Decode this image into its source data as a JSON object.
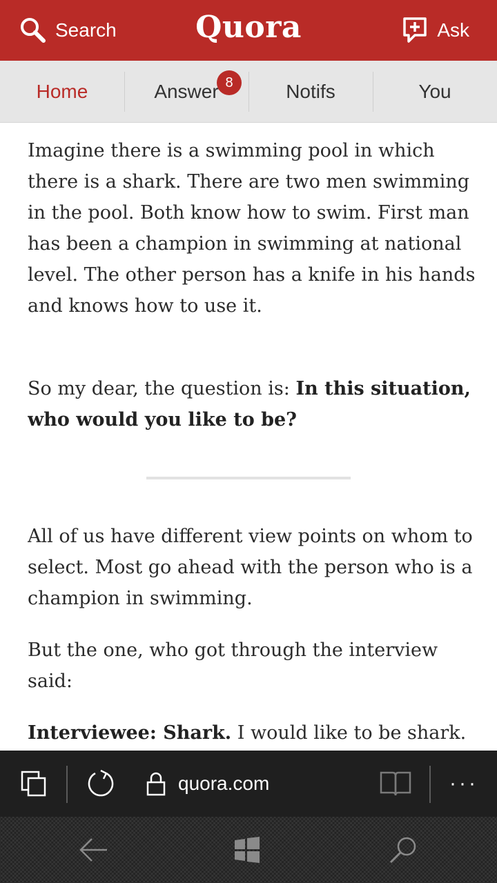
{
  "header": {
    "search_label": "Search",
    "logo_text": "Quora",
    "ask_label": "Ask",
    "bg_color": "#b92b27"
  },
  "tabs": [
    {
      "label": "Home",
      "active": true
    },
    {
      "label": "Answer",
      "badge": "8"
    },
    {
      "label": "Notifs"
    },
    {
      "label": "You"
    }
  ],
  "article": {
    "p1": "Imagine there is a swimming pool in which there is a shark. There are two men swimming in the pool. Both know how to swim. First man has been a champion in swimming at national level. The other person has a knife in his hands and knows how to use it.",
    "p2_text": "So my dear, the question is: ",
    "p2_bold": "In this situation, who would you like to be?",
    "p3": "All of us have different view points on whom to select. Most go ahead with the person who is a champion in swimming.",
    "p4": "But the one, who got through the interview said:",
    "p5_bold": "Interviewee: Shark.",
    "p5_text": " I would like to be shark."
  },
  "browser": {
    "url": "quora.com",
    "icons": [
      "tabs-icon",
      "refresh-icon",
      "lock-icon",
      "reading-view-icon",
      "more-icon"
    ]
  },
  "system_nav": {
    "icons": [
      "back-icon",
      "windows-start-icon",
      "search-icon"
    ]
  }
}
